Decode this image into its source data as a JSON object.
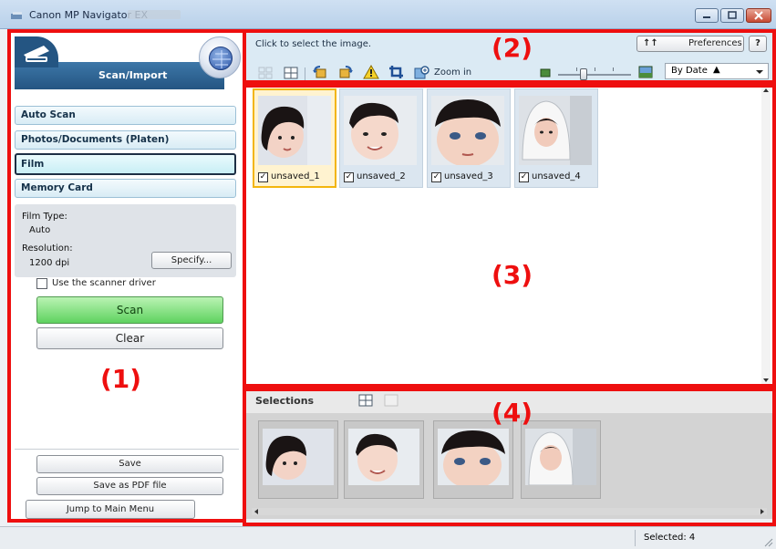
{
  "window": {
    "title": "Canon MP Navigator EX"
  },
  "left_panel": {
    "header_title": "Scan/Import",
    "modes": [
      {
        "label": "Auto Scan",
        "active": false
      },
      {
        "label": "Photos/Documents (Platen)",
        "active": false
      },
      {
        "label": "Film",
        "active": true
      },
      {
        "label": "Memory Card",
        "active": false
      }
    ],
    "film_type_label": "Film Type:",
    "film_type_value": "Auto",
    "resolution_label": "Resolution:",
    "resolution_value": "1200 dpi",
    "specify_label": "Specify...",
    "use_driver_label": "Use the scanner driver",
    "use_driver_checked": false,
    "scan_label": "Scan",
    "clear_label": "Clear",
    "save_label": "Save",
    "save_pdf_label": "Save as PDF file",
    "jump_label": "Jump to Main Menu"
  },
  "toolbar": {
    "hint": "Click to select the image.",
    "preferences_label": "Preferences",
    "help_label": "?",
    "zoom_in_label": "Zoom in",
    "sort_value": "By Date",
    "sort_arrow": "▲"
  },
  "thumbnails": [
    {
      "name": "unsaved_1",
      "checked": true,
      "selected": true
    },
    {
      "name": "unsaved_2",
      "checked": true,
      "selected": false
    },
    {
      "name": "unsaved_3",
      "checked": true,
      "selected": false
    },
    {
      "name": "unsaved_4",
      "checked": true,
      "selected": false
    }
  ],
  "selections": {
    "title": "Selections",
    "count": 4
  },
  "status": {
    "selected_text": "Selected: 4"
  },
  "callouts": [
    "(1)",
    "(2)",
    "(3)",
    "(4)"
  ],
  "colors": {
    "callout_red": "#ee0f0f",
    "scan_green": "#5fd25f",
    "header_blue": "#245582",
    "selected_border": "#f3b50d"
  }
}
